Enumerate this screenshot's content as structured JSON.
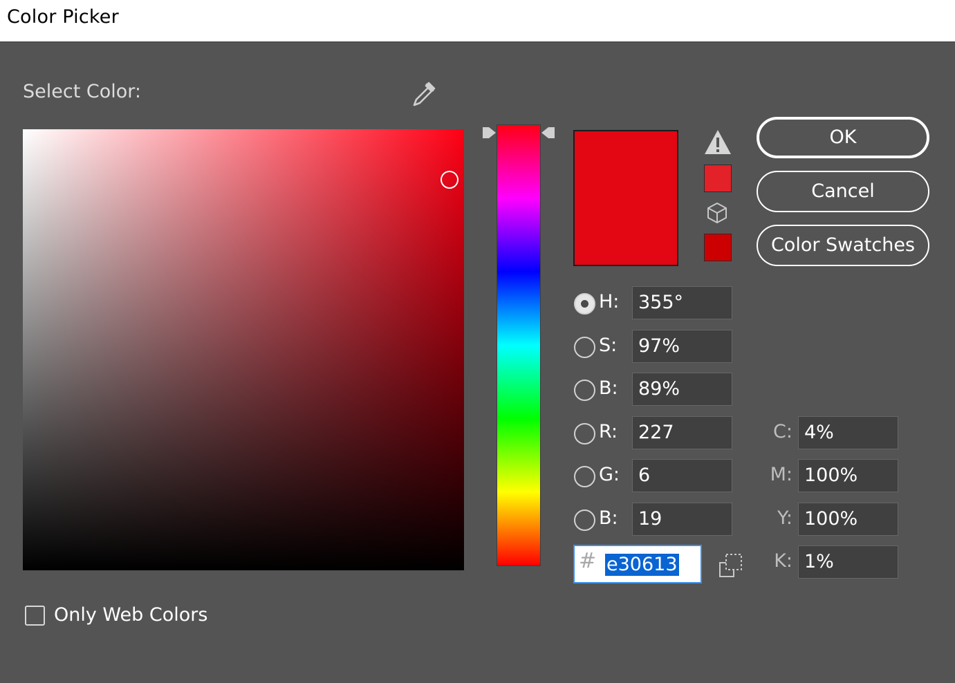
{
  "window": {
    "title": "Color Picker"
  },
  "picker": {
    "select_label": "Select Color:",
    "eyedropper_icon": "eyedropper-icon",
    "hue_base_color": "#ff0015"
  },
  "preview": {
    "new_color": "#e30613",
    "current_color": "#e30613",
    "gamut_warning_icon": "warning-triangle-icon",
    "gamut_swatch_color": "#e22129",
    "web_safe_icon": "cube-icon",
    "web_safe_swatch_color": "#cc0000"
  },
  "buttons": {
    "ok": "OK",
    "cancel": "Cancel",
    "swatches": "Color Swatches"
  },
  "hsb_rgb": [
    {
      "label": "H:",
      "value": "355°",
      "selected": true
    },
    {
      "label": "S:",
      "value": "97%",
      "selected": false
    },
    {
      "label": "B:",
      "value": "89%",
      "selected": false
    },
    {
      "label": "R:",
      "value": "227",
      "selected": false
    },
    {
      "label": "G:",
      "value": "6",
      "selected": false
    },
    {
      "label": "B:",
      "value": "19",
      "selected": false
    }
  ],
  "cmyk": [
    {
      "label": "C:",
      "value": "4%"
    },
    {
      "label": "M:",
      "value": "100%"
    },
    {
      "label": "Y:",
      "value": "100%"
    },
    {
      "label": "K:",
      "value": "1%"
    }
  ],
  "hex": {
    "prefix": "#",
    "value": "e30613"
  },
  "only_web_colors": {
    "label": "Only Web Colors",
    "checked": false
  }
}
